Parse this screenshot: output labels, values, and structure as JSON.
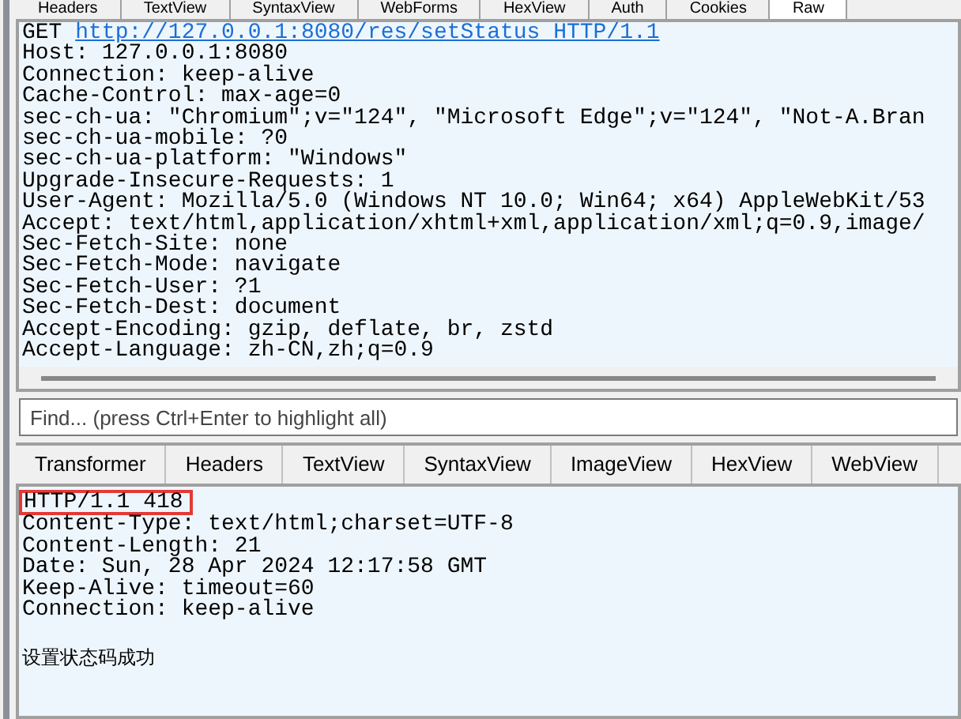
{
  "request_tabs": [
    {
      "label": "Headers",
      "selected": false
    },
    {
      "label": "TextView",
      "selected": false
    },
    {
      "label": "SyntaxView",
      "selected": false
    },
    {
      "label": "WebForms",
      "selected": false
    },
    {
      "label": "HexView",
      "selected": false
    },
    {
      "label": "Auth",
      "selected": false
    },
    {
      "label": "Cookies",
      "selected": false
    },
    {
      "label": "Raw",
      "selected": true
    }
  ],
  "request": {
    "method": "GET",
    "url": "http://127.0.0.1:8080/res/setStatus HTTP/1.1",
    "lines": [
      "Host: 127.0.0.1:8080",
      "Connection: keep-alive",
      "Cache-Control: max-age=0",
      "sec-ch-ua: \"Chromium\";v=\"124\", \"Microsoft Edge\";v=\"124\", \"Not-A.Bran",
      "sec-ch-ua-mobile: ?0",
      "sec-ch-ua-platform: \"Windows\"",
      "Upgrade-Insecure-Requests: 1",
      "User-Agent: Mozilla/5.0 (Windows NT 10.0; Win64; x64) AppleWebKit/53",
      "Accept: text/html,application/xhtml+xml,application/xml;q=0.9,image/",
      "Sec-Fetch-Site: none",
      "Sec-Fetch-Mode: navigate",
      "Sec-Fetch-User: ?1",
      "Sec-Fetch-Dest: document",
      "Accept-Encoding: gzip, deflate, br, zstd",
      "Accept-Language: zh-CN,zh;q=0.9"
    ]
  },
  "find": {
    "placeholder": "Find... (press Ctrl+Enter to highlight all)"
  },
  "response_tabs": [
    {
      "label": "Transformer",
      "selected": false
    },
    {
      "label": "Headers",
      "selected": false
    },
    {
      "label": "TextView",
      "selected": false
    },
    {
      "label": "SyntaxView",
      "selected": false
    },
    {
      "label": "ImageView",
      "selected": false
    },
    {
      "label": "HexView",
      "selected": false
    },
    {
      "label": "WebView",
      "selected": false
    }
  ],
  "response": {
    "status_line": "HTTP/1.1 418",
    "status_highlighted": true,
    "lines": [
      "Content-Type: text/html;charset=UTF-8",
      "Content-Length: 21",
      "Date: Sun, 28 Apr 2024 12:17:58 GMT",
      "Keep-Alive: timeout=60",
      "Connection: keep-alive"
    ],
    "body": "设置状态码成功"
  }
}
